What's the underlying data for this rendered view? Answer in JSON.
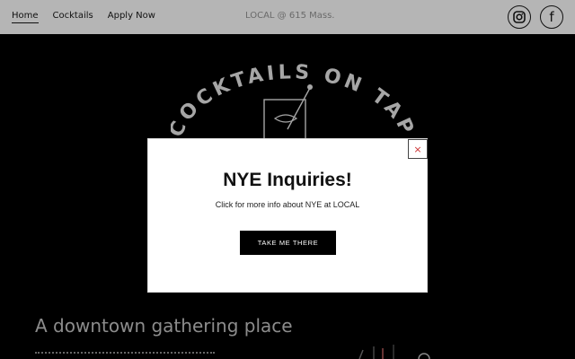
{
  "header": {
    "nav": [
      {
        "label": "Home",
        "active": true
      },
      {
        "label": "Cocktails",
        "active": false
      },
      {
        "label": "Apply Now",
        "active": false
      }
    ],
    "center_text": "LOCAL @ 615 Mass.",
    "social": [
      {
        "name": "instagram-icon"
      },
      {
        "name": "facebook-icon",
        "glyph": "f"
      }
    ]
  },
  "hero": {
    "logo_text": "COCKTAILS ON TAP",
    "tagline": "A downtown gathering place"
  },
  "modal": {
    "close_glyph": "×",
    "title": "NYE Inquiries!",
    "description": "Click for more info about NYE at LOCAL",
    "button_label": "TAKE ME THERE"
  },
  "colors": {
    "header_bg": "#b5b5b5",
    "page_bg": "#000000",
    "modal_bg": "#ffffff",
    "button_bg": "#000000",
    "close_x": "#cc3333"
  }
}
